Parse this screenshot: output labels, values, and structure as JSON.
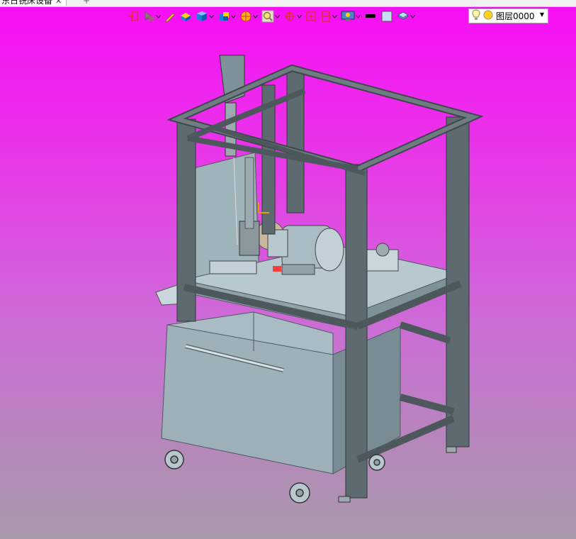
{
  "tab": {
    "title": "东日铣床设备",
    "close_glyph": "✕",
    "new_tab_glyph": "+"
  },
  "toolbar": {
    "tools": [
      {
        "name": "insert-icon",
        "dropdown": false
      },
      {
        "name": "pointer-icon",
        "dropdown": true
      },
      {
        "name": "pencil-icon",
        "dropdown": false
      },
      {
        "name": "solid-box-icon",
        "dropdown": false
      },
      {
        "name": "cube-icon",
        "dropdown": true
      },
      {
        "name": "multi-cube-icon",
        "dropdown": true
      },
      {
        "name": "sphere-icon",
        "dropdown": true
      },
      {
        "name": "zoom-icon",
        "dropdown": true
      },
      {
        "name": "rotate-axis-icon",
        "dropdown": true
      },
      {
        "name": "fit-view-icon",
        "dropdown": false
      },
      {
        "name": "section-icon",
        "dropdown": true
      },
      {
        "name": "display-mode-icon",
        "dropdown": true
      },
      {
        "name": "line-color-icon",
        "dropdown": false
      },
      {
        "name": "fill-color-icon",
        "dropdown": false
      },
      {
        "name": "layer-stack-icon",
        "dropdown": true
      }
    ],
    "colors": {
      "line": "#000000",
      "fill": "#c8e0f4"
    }
  },
  "layer_selector": {
    "value": "图层0000",
    "options_arrow": "▼"
  },
  "viewport": {
    "background_top": "#f80cf6",
    "background_bottom": "#a79aab",
    "model_color": "#a9bcc3",
    "frame_color": "#5d6a70"
  }
}
